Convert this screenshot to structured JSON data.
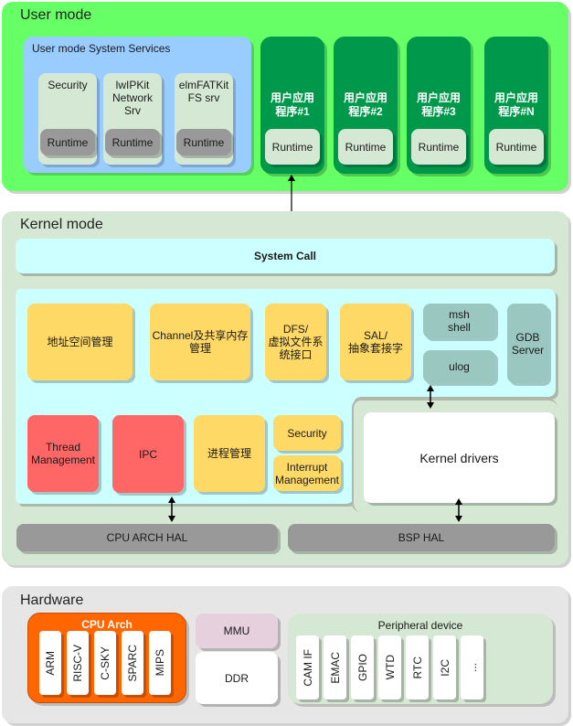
{
  "colors": {
    "user_mode_bg": "#66ff66",
    "user_services_bg": "#99ccff",
    "service_card_bg": "#d5e8d4",
    "runtime_gray": "#999999",
    "app_green": "#00994c",
    "kernel_bg": "#d5e8d4",
    "syscall_bg": "#ccffff",
    "kernel_yellow": "#ffd966",
    "kernel_red": "#ff6666",
    "teal_gray": "#9ac7bf",
    "hal_gray": "#999999",
    "hardware_bg": "#e6e6e6",
    "cpu_orange": "#ff6600",
    "mmu_pink": "#e6d0de",
    "peripheral_bg": "#d5e8d4"
  },
  "user_mode": {
    "title": "User mode",
    "system_services": {
      "title": "User mode System Services",
      "services": [
        {
          "name": "Security",
          "runtime": "Runtime"
        },
        {
          "name": "lwIPKit\nNetwork Srv",
          "runtime": "Runtime"
        },
        {
          "name": "elmFATKit\nFS srv",
          "runtime": "Runtime"
        }
      ]
    },
    "apps": [
      {
        "name": "用户应用\n程序#1",
        "runtime": "Runtime"
      },
      {
        "name": "用户应用\n程序#2",
        "runtime": "Runtime"
      },
      {
        "name": "用户应用\n程序#3",
        "runtime": "Runtime"
      },
      {
        "name": "用户应用\n程序#N",
        "runtime": "Runtime"
      }
    ]
  },
  "kernel_mode": {
    "title": "Kernel mode",
    "system_call": "System Call",
    "modules_top": [
      {
        "id": "address-space",
        "label": "地址空间管理"
      },
      {
        "id": "channel-shm",
        "label": "Channel及共享内存\n管理"
      },
      {
        "id": "dfs",
        "label": "DFS/\n虚拟文件系\n统接口"
      },
      {
        "id": "sal",
        "label": "SAL/\n抽象套接字"
      }
    ],
    "msh_shell": "msh\nshell",
    "ulog": "ulog",
    "gdb_server": "GDB\nServer",
    "modules_bottom": [
      {
        "id": "thread-management",
        "label": "Thread\nManagement"
      },
      {
        "id": "ipc",
        "label": "IPC"
      },
      {
        "id": "process-management",
        "label": "进程管理"
      }
    ],
    "security": "Security",
    "interrupt_management": "Interrupt\nManagement",
    "kernel_drivers": "Kernel drivers",
    "cpu_arch_hal": "CPU ARCH HAL",
    "bsp_hal": "BSP HAL"
  },
  "hardware": {
    "title": "Hardware",
    "cpu_arch": {
      "title": "CPU Arch",
      "items": [
        "ARM",
        "RISC-V",
        "C-SKY",
        "SPARC",
        "MIPS"
      ]
    },
    "mmu": "MMU",
    "ddr": "DDR",
    "peripheral": {
      "title": "Peripheral device",
      "items": [
        "CAM IF",
        "EMAC",
        "GPIO",
        "WTD",
        "RTC",
        "I2C",
        "..."
      ]
    }
  }
}
